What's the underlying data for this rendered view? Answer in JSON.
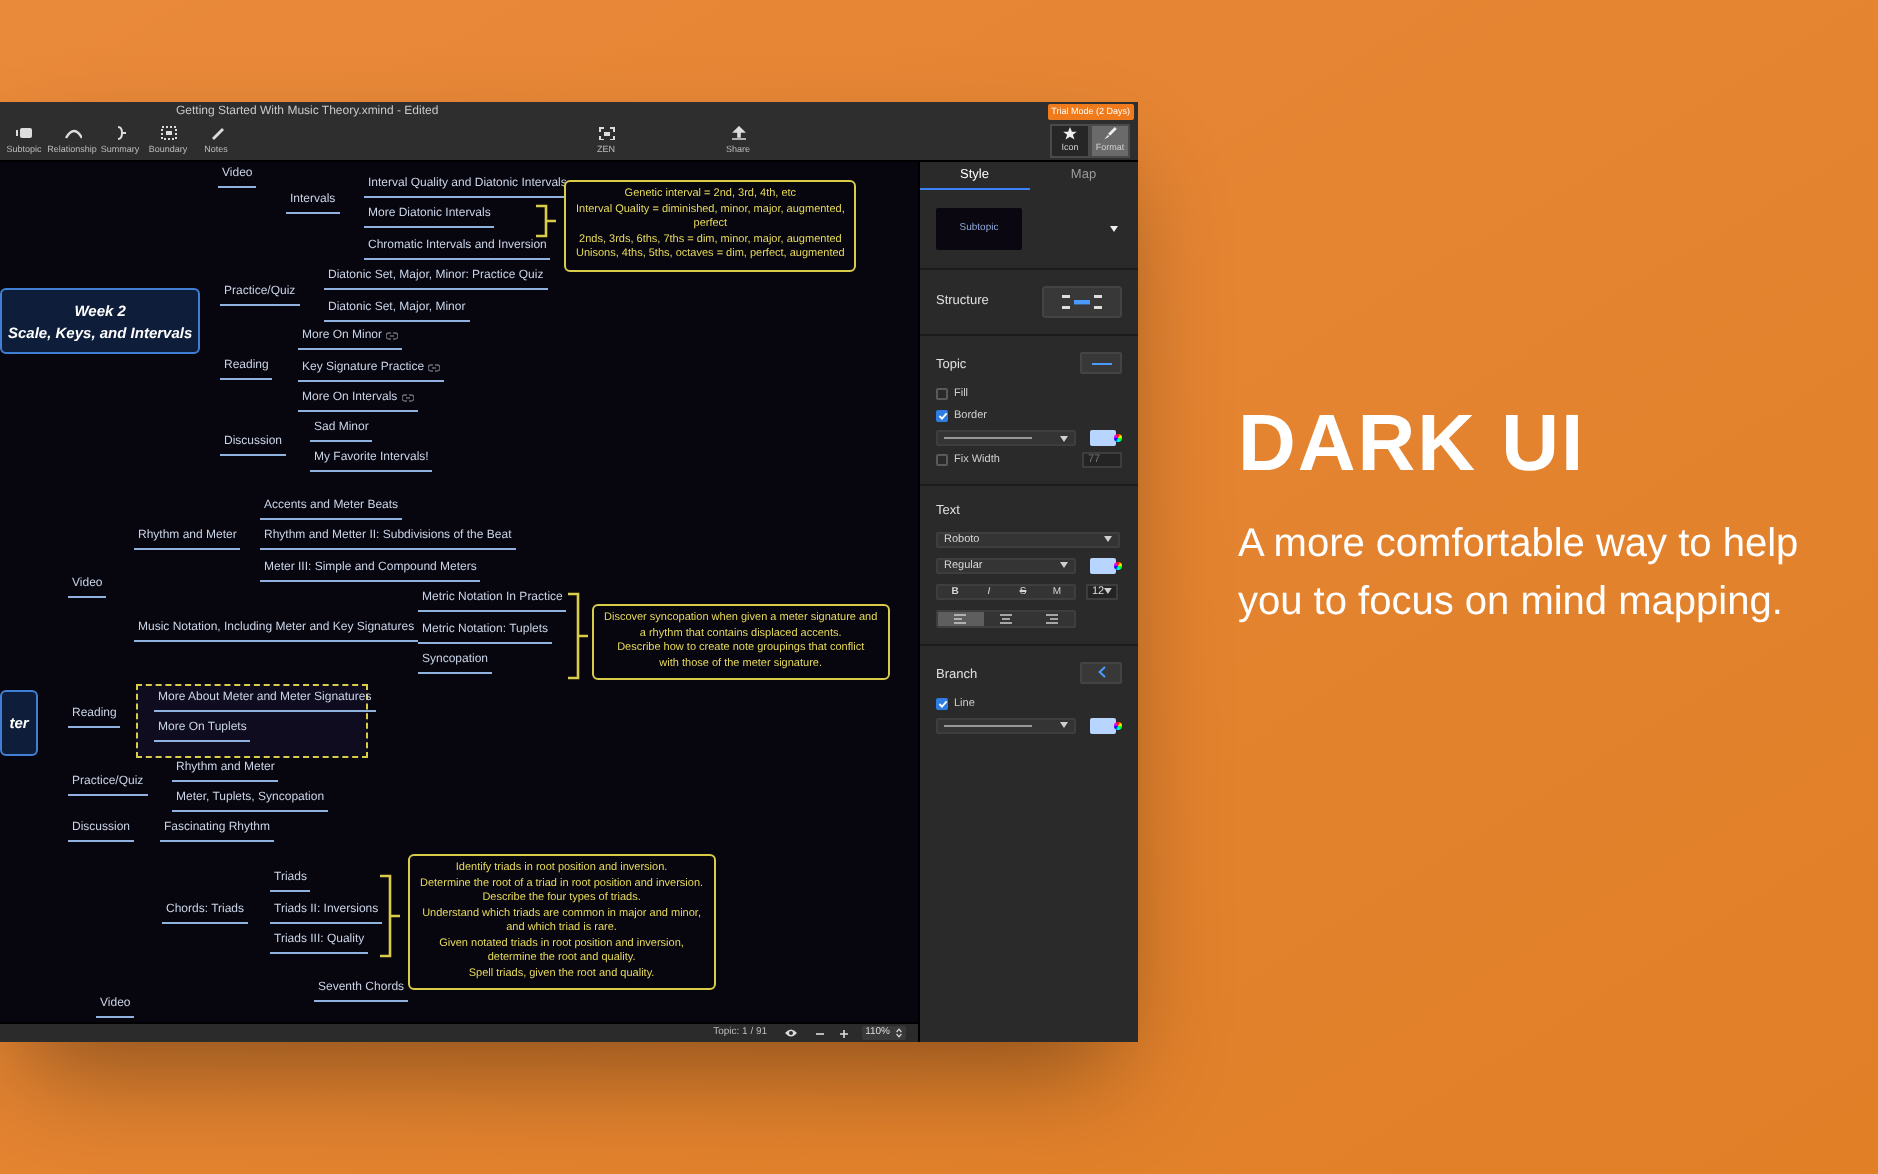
{
  "window": {
    "title": "Getting Started With Music Theory.xmind - Edited",
    "trial_badge": "Trial Mode (2 Days)",
    "toolbar": [
      {
        "label": "Subtopic"
      },
      {
        "label": "Relationship"
      },
      {
        "label": "Summary"
      },
      {
        "label": "Boundary"
      },
      {
        "label": "Notes"
      }
    ],
    "toolbar_center": [
      {
        "label": "ZEN"
      },
      {
        "label": "Share"
      }
    ],
    "toolbar_right": [
      {
        "label": "Icon",
        "selected": false
      },
      {
        "label": "Format",
        "selected": true
      }
    ]
  },
  "mind_map": {
    "trees": [
      {
        "central": "Week 2\nScale, Keys, and Intervals",
        "branches": [
          {
            "text": "Video",
            "children": [
              {
                "text": "Intervals",
                "children": [
                  {
                    "text": "Interval Quality and Diatonic Intervals"
                  },
                  {
                    "text": "More Diatonic Intervals"
                  },
                  {
                    "text": "Chromatic Intervals and Inversion"
                  }
                ]
              }
            ]
          },
          {
            "text": "Practice/Quiz",
            "children": [
              {
                "text": "Diatonic Set, Major, Minor: Practice Quiz"
              },
              {
                "text": "Diatonic Set, Major, Minor"
              }
            ]
          },
          {
            "text": "Reading",
            "children": [
              {
                "text": "More On Minor",
                "link": true
              },
              {
                "text": "Key Signature Practice",
                "link": true
              },
              {
                "text": "More On Intervals",
                "link": true
              }
            ]
          },
          {
            "text": "Discussion",
            "children": [
              {
                "text": "Sad Minor"
              },
              {
                "text": "My Favorite Intervals!"
              }
            ]
          }
        ],
        "summaries": [
          {
            "text": "Genetic interval = 2nd, 3rd, 4th, etc\nInterval Quality = diminished, minor, major, augmented,\nperfect\n2nds, 3rds, 6ths, 7ths = dim, minor, major, augmented\nUnisons, 4ths, 5ths, octaves = dim, perfect, augmented"
          }
        ]
      },
      {
        "central": "ter",
        "branches": [
          {
            "text": "Video",
            "children": [
              {
                "text": "Rhythm and Meter",
                "children": [
                  {
                    "text": "Accents and Meter Beats"
                  },
                  {
                    "text": "Rhythm and Metter II: Subdivisions of the Beat"
                  },
                  {
                    "text": "Meter III: Simple and Compound Meters"
                  }
                ]
              },
              {
                "text": "Music Notation, Including Meter and Key Signatures",
                "children": [
                  {
                    "text": "Metric Notation In Practice"
                  },
                  {
                    "text": "Metric Notation: Tuplets"
                  },
                  {
                    "text": "Syncopation"
                  }
                ]
              }
            ]
          },
          {
            "text": "Reading",
            "boundary": true,
            "children": [
              {
                "text": "More About Meter and Meter Signatures"
              },
              {
                "text": "More On Tuplets"
              }
            ]
          },
          {
            "text": "Practice/Quiz",
            "children": [
              {
                "text": "Rhythm and Meter"
              },
              {
                "text": "Meter, Tuplets, Syncopation"
              }
            ]
          },
          {
            "text": "Discussion",
            "children": [
              {
                "text": "Fascinating Rhythm"
              }
            ]
          }
        ],
        "summaries": [
          {
            "text": "Discover syncopation when given a meter signature and\na rhythm that contains displaced accents.\nDescribe how to create note groupings that conflict\nwith those of the meter signature."
          }
        ]
      },
      {
        "branches": [
          {
            "text": "Video",
            "children": [
              {
                "text": "Chords: Triads",
                "children": [
                  {
                    "text": "Triads"
                  },
                  {
                    "text": "Triads II: Inversions"
                  },
                  {
                    "text": "Triads III: Quality"
                  }
                ]
              },
              {
                "text": "Seventh Chords"
              }
            ]
          }
        ],
        "summaries": [
          {
            "text": "Identify triads in root position and inversion.\nDetermine the root of a triad in root position and inversion.\nDescribe the four types of triads.\nUnderstand which triads are common in major and minor,\nand which triad is rare.\nGiven notated triads in root position and inversion,\ndetermine the root and quality.\nSpell triads, given the root and quality."
          }
        ]
      }
    ]
  },
  "status_bar": {
    "topic_count": "Topic: 1 / 91",
    "zoom": "110%"
  },
  "format_panel": {
    "tabs": [
      {
        "label": "Style",
        "selected": true
      },
      {
        "label": "Map",
        "selected": false
      }
    ],
    "style_preview": "Subtopic",
    "structure": {
      "label": "Structure"
    },
    "topic": {
      "label": "Topic",
      "options": [
        {
          "label": "Fill",
          "checked": false
        },
        {
          "label": "Border",
          "checked": true
        }
      ],
      "fix_width": {
        "label": "Fix Width",
        "checked": false,
        "placeholder": "77"
      }
    },
    "text": {
      "label": "Text",
      "font": "Roboto",
      "weight": "Regular",
      "styles": [
        {
          "kind": "bold",
          "label": "B"
        },
        {
          "kind": "italic",
          "label": "I"
        },
        {
          "kind": "strike",
          "label": "S"
        },
        {
          "kind": "case",
          "label": "M"
        }
      ],
      "size": "12",
      "align": [
        {
          "kind": "left",
          "selected": true
        },
        {
          "kind": "center",
          "selected": false
        },
        {
          "kind": "right",
          "selected": false
        }
      ]
    },
    "branch": {
      "label": "Branch",
      "line": {
        "label": "Line",
        "checked": true
      }
    }
  },
  "promo": {
    "headline": "DARK UI",
    "tagline": "A more comfortable way to help you to focus on mind mapping."
  }
}
